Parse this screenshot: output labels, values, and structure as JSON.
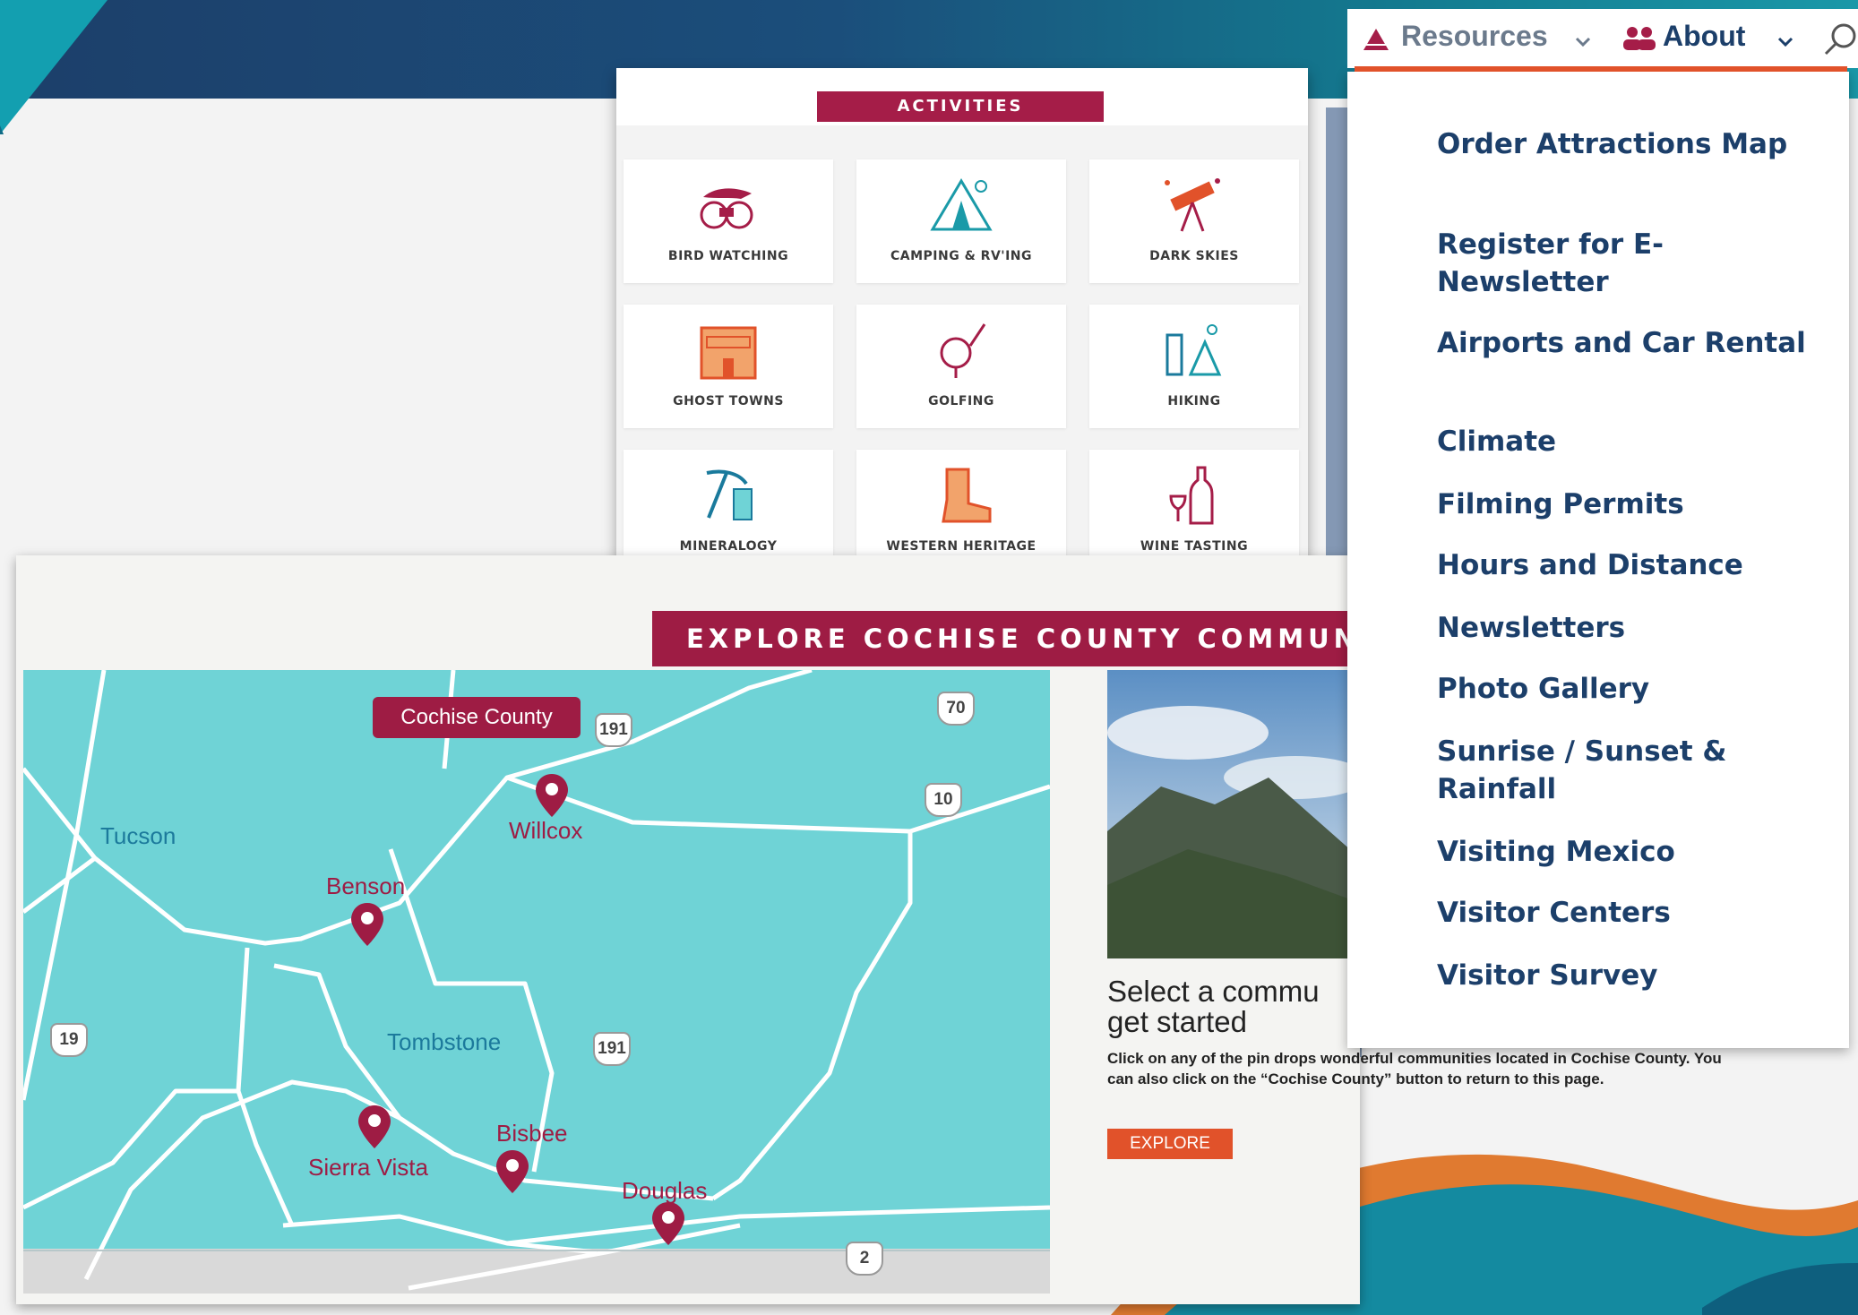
{
  "activities": {
    "title": "ACTIVITIES",
    "tiles": [
      {
        "label": "BIRD WATCHING",
        "icon": "binoculars-icon"
      },
      {
        "label": "CAMPING & RV'ING",
        "icon": "tent-icon"
      },
      {
        "label": "DARK SKIES",
        "icon": "telescope-icon"
      },
      {
        "label": "GHOST TOWNS",
        "icon": "old-building-icon"
      },
      {
        "label": "GOLFING",
        "icon": "golf-icon"
      },
      {
        "label": "HIKING",
        "icon": "hiker-icon"
      },
      {
        "label": "MINERALOGY",
        "icon": "pickaxe-icon"
      },
      {
        "label": "WESTERN HERITAGE",
        "icon": "cowboy-boot-icon"
      },
      {
        "label": "WINE TASTING",
        "icon": "wine-bottle-icon"
      }
    ]
  },
  "explore": {
    "title": "EXPLORE COCHISE COUNTY COMMUNIT",
    "county_button": "Cochise County",
    "cities": {
      "tucson": "Tucson",
      "benson": "Benson",
      "willcox": "Willcox",
      "tombstone": "Tombstone",
      "sierra_vista": "Sierra Vista",
      "bisbee": "Bisbee",
      "douglas": "Douglas"
    },
    "highways": {
      "h191a": "191",
      "h70": "70",
      "h10": "10",
      "h19": "19",
      "h191b": "191",
      "h2": "2"
    },
    "select_title_line1": "Select a commu",
    "select_title_line2": "get started",
    "description": "Click on any of the pin drops wonderful communities located in Cochise County. You can also click on the “Cochise County” button to return to this page.",
    "explore_button": "EXPLORE"
  },
  "nav": {
    "resources": "Resources",
    "about": "About",
    "resources_icon": "pyramid-icon",
    "about_icon": "people-icon",
    "accent": "#e1522a"
  },
  "dropdown": {
    "items": [
      "Order Attractions Map",
      "Register for E-Newsletter",
      "Airports and Car Rental",
      "Climate",
      "Filming Permits",
      "Hours and Distance",
      "Newsletters",
      "Photo Gallery",
      "Sunrise / Sunset & Rainfall",
      "Visiting Mexico",
      "Visitor Centers",
      "Visitor Survey"
    ]
  },
  "colors": {
    "brand_red": "#a51d48",
    "map_teal": "#6fd3d6",
    "nav_blue": "#1c3f6a"
  }
}
